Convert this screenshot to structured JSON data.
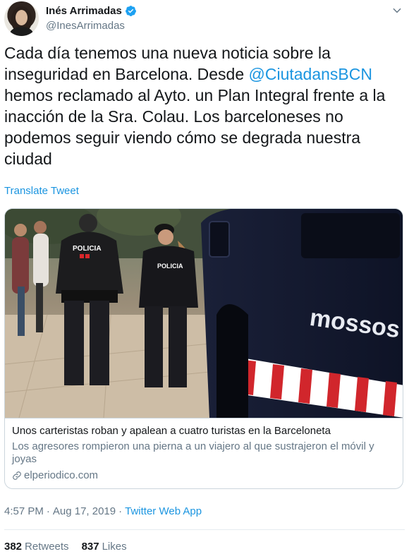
{
  "author": {
    "display_name": "Inés Arrimadas",
    "handle": "@InesArrimadas",
    "verified": true,
    "verified_icon": "verified-badge-icon",
    "menu_icon": "chevron-down-icon"
  },
  "tweet": {
    "text_before_mention": "Cada día tenemos una nueva noticia sobre la inseguridad en Barcelona. Desde ",
    "mention": "@CiutadansBCN",
    "text_after_mention": " hemos reclamado al Ayto. un Plan Integral frente a la inacción de la Sra. Colau. Los barceloneses no podemos seguir viendo cómo se degrada nuestra ciudad",
    "translate_label": "Translate Tweet"
  },
  "card": {
    "title": "Unos carteristas roban y apalean a cuatro turistas en la Barceloneta",
    "description": "Los agresores rompieron una pierna a un viajero al que sustrajeron el móvil y joyas",
    "domain": "elperiodico.com",
    "link_icon": "link-icon",
    "image": {
      "van_lettering": "mossos",
      "vest_label_1": "POLICIA",
      "vest_label_2": "POLICIA"
    }
  },
  "meta": {
    "time": "4:57 PM",
    "separator": "·",
    "date": "Aug 17, 2019",
    "separator2": "·",
    "source": "Twitter Web App"
  },
  "stats": {
    "retweets_count": "382",
    "retweets_label": "Retweets",
    "likes_count": "837",
    "likes_label": "Likes"
  },
  "colors": {
    "link": "#1b95e0",
    "text": "#14171a",
    "secondary": "#657786",
    "border": "#ccd6dd"
  }
}
